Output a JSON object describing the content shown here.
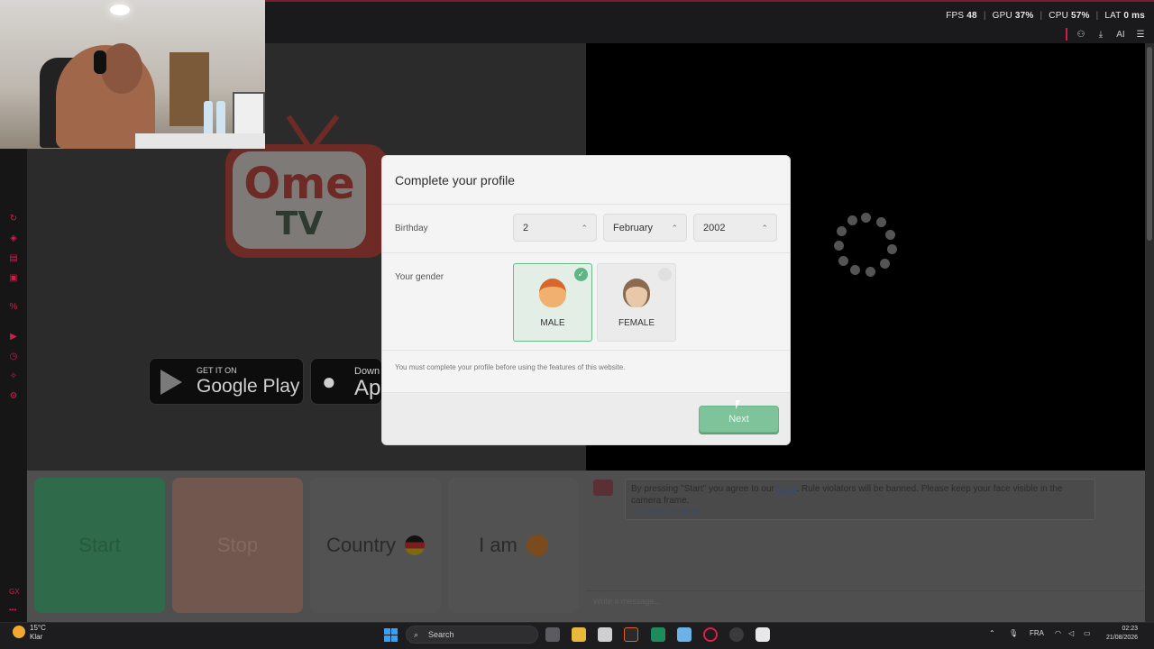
{
  "perf": {
    "fps_label": "FPS",
    "fps": "48",
    "gpu_label": "GPU",
    "gpu": "37",
    "cpu_label": "CPU",
    "cpu": "57",
    "lat_label": "LAT",
    "lat": "0 ms",
    "percent": "%"
  },
  "browser": {
    "icons": [
      "profile-icon",
      "download-icon",
      "ai-icon",
      "menu-icon"
    ],
    "ai_label": "AI"
  },
  "logo": {
    "ome": "Ome",
    "tv": "TV"
  },
  "stores": {
    "google_small": "GET IT ON",
    "google_big": "Google Play",
    "apple_small": "Down",
    "apple_big": "Ap"
  },
  "controls": {
    "start": "Start",
    "stop": "Stop",
    "country": "Country",
    "iam": "I am"
  },
  "chat": {
    "msg_before": "By pressing \"Start\" you agree to our ",
    "msg_link": "rules",
    "msg_after": ". Rule violators will be banned. Please keep your face visible in the camera frame.",
    "warning_icon": "⚠",
    "safety": "Safety Reminder",
    "input_placeholder": "Write a message..."
  },
  "modal": {
    "title": "Complete your profile",
    "birthday_label": "Birthday",
    "day": "2",
    "month": "February",
    "year": "2002",
    "gender_label": "Your gender",
    "male": "MALE",
    "female": "FEMALE",
    "selected_gender": "MALE",
    "note": "You must complete your profile before using the features of this website.",
    "next": "Next"
  },
  "taskbar": {
    "temp": "15°C",
    "weather": "Klar",
    "search": "Search",
    "lang": "FRA",
    "time": "02:23",
    "date": "21/08/2026"
  },
  "colors": {
    "accent_red": "#d01c4b",
    "start_green": "#2f6b4b",
    "next_green": "#7fc39b",
    "male_selected": "#69b989"
  }
}
